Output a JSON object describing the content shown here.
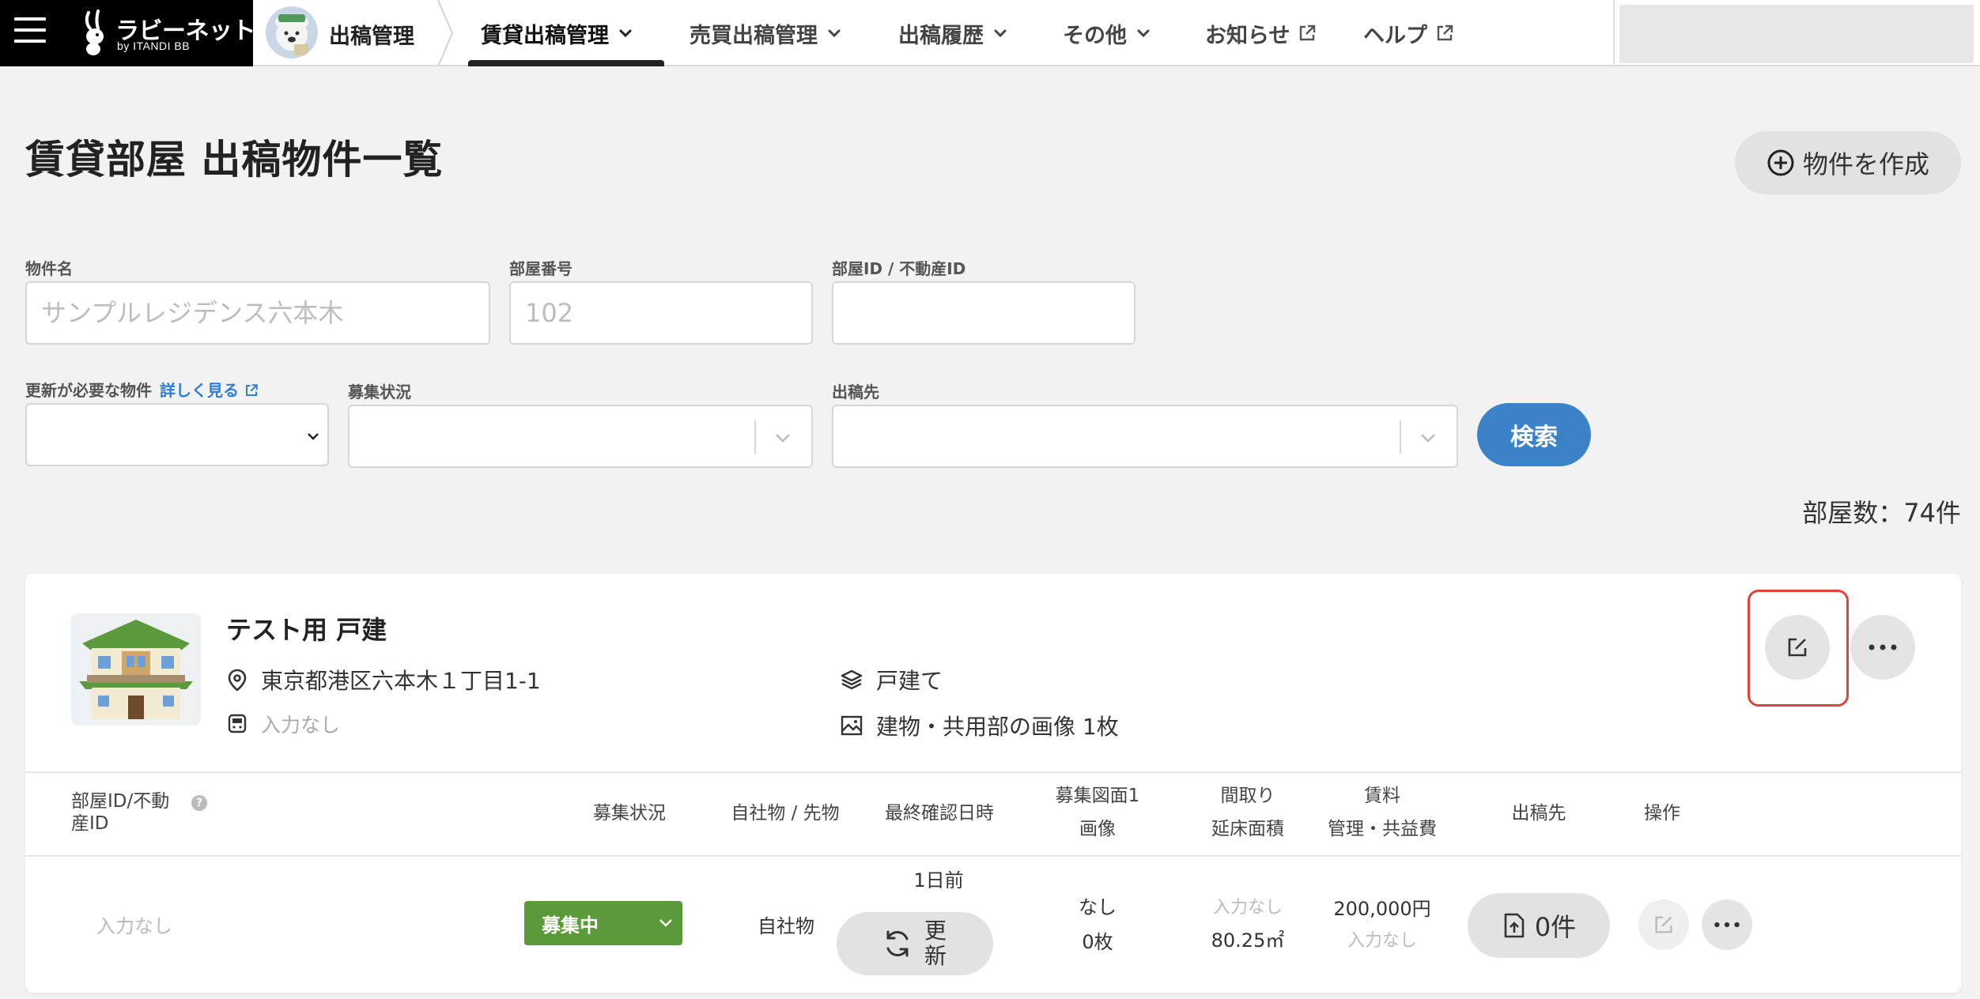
{
  "nav": {
    "brand": {
      "name": "ラビーネットBB",
      "sub": "by ITANDI BB"
    },
    "breadcrumb": "出稿管理",
    "items": [
      {
        "label": "賃貸出稿管理"
      },
      {
        "label": "売買出稿管理"
      },
      {
        "label": "出稿履歴"
      },
      {
        "label": "その他"
      },
      {
        "label": "お知らせ"
      },
      {
        "label": "ヘルプ"
      }
    ]
  },
  "page": {
    "title": "賃貸部屋 出稿物件一覧",
    "create_button": "物件を作成"
  },
  "filters": {
    "property_name": {
      "label": "物件名",
      "placeholder": "サンプルレジデンス六本木"
    },
    "room_number": {
      "label": "部屋番号",
      "placeholder": "102"
    },
    "room_id": {
      "label": "部屋ID / 不動産ID",
      "placeholder": ""
    },
    "needs_update": {
      "label": "更新が必要な物件",
      "link": "詳しく見る"
    },
    "recruit_status": {
      "label": "募集状況"
    },
    "destination": {
      "label": "出稿先"
    },
    "search_button": "検索"
  },
  "room_count": "部屋数：74件",
  "property": {
    "name": "テスト用 戸建",
    "address": "東京都港区六本木１丁目1-1",
    "station": "入力なし",
    "building_type": "戸建て",
    "images": "建物・共用部の画像 1枚"
  },
  "table": {
    "headers": {
      "room_id": "部屋ID/不動産ID",
      "status": "募集状況",
      "own": "自社物 / 先物",
      "last_check": "最終確認日時",
      "floorplan_1": "募集図面1",
      "floorplan_2": "画像",
      "layout_1": "間取り",
      "layout_2": "延床面積",
      "rent_1": "賃料",
      "rent_2": "管理・共益費",
      "dest": "出稿先",
      "ops": "操作"
    },
    "row": {
      "room_id": "入力なし",
      "status": "募集中",
      "own": "自社物",
      "last_check": "1日前",
      "update_label": "更新",
      "floorplan": "なし",
      "images": "0枚",
      "layout": "入力なし",
      "area": "80.25㎡",
      "rent": "200,000円",
      "fee": "入力なし",
      "dest_count": "0件"
    }
  },
  "colors": {
    "accent": "#3b82c9",
    "status_green": "#5a9a3a",
    "highlight": "#e0443a"
  }
}
